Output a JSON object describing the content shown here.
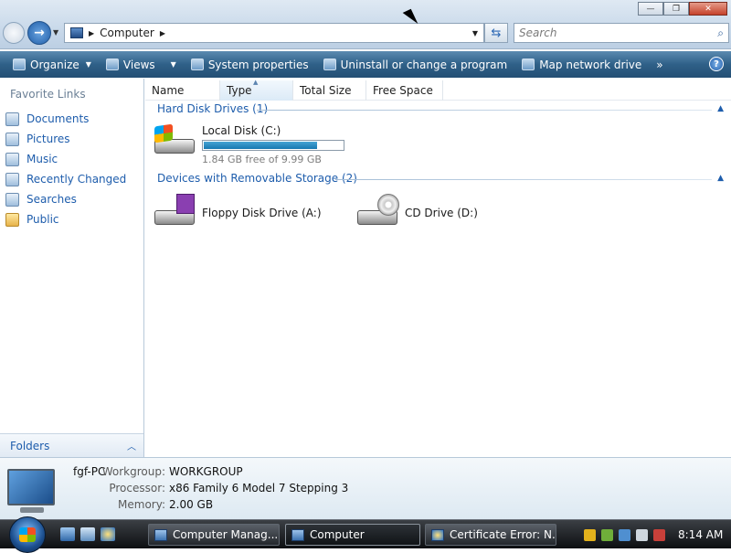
{
  "window": {
    "address": {
      "crumb": "Computer"
    },
    "search": {
      "placeholder": "Search"
    }
  },
  "toolbar": {
    "items": [
      {
        "label": "Organize",
        "icon": "organize-icon",
        "dropdown": true
      },
      {
        "label": "Views",
        "icon": "views-icon",
        "dropdown": true
      },
      {
        "label": "System properties",
        "icon": "system-properties-icon"
      },
      {
        "label": "Uninstall or change a program",
        "icon": "uninstall-icon"
      },
      {
        "label": "Map network drive",
        "icon": "map-drive-icon"
      }
    ],
    "more": "»",
    "help": "?"
  },
  "sidebar": {
    "title": "Favorite Links",
    "items": [
      {
        "label": "Documents"
      },
      {
        "label": "Pictures"
      },
      {
        "label": "Music"
      },
      {
        "label": "Recently Changed"
      },
      {
        "label": "Searches"
      },
      {
        "label": "Public"
      }
    ],
    "folders": "Folders"
  },
  "columns": [
    "Name",
    "Type",
    "Total Size",
    "Free Space"
  ],
  "groups": {
    "hard_disk": {
      "title": "Hard Disk Drives (1)"
    },
    "removable": {
      "title": "Devices with Removable Storage (2)"
    }
  },
  "drives": {
    "c": {
      "name": "Local Disk (C:)",
      "free_text": "1.84 GB free of 9.99 GB",
      "used_fraction": 0.816
    },
    "a": {
      "name": "Floppy Disk Drive (A:)"
    },
    "d": {
      "name": "CD Drive (D:)"
    }
  },
  "details": {
    "pc_name": "fgf-PC",
    "workgroup_label": "Workgroup:",
    "workgroup": "WORKGROUP",
    "processor_label": "Processor:",
    "processor": "x86 Family 6 Model 7 Stepping 3",
    "memory_label": "Memory:",
    "memory": "2.00 GB"
  },
  "taskbar": {
    "tasks": [
      {
        "label": "Computer Manag..."
      },
      {
        "label": "Computer"
      },
      {
        "label": "Certificate Error: N..."
      }
    ],
    "clock": "8:14 AM"
  }
}
